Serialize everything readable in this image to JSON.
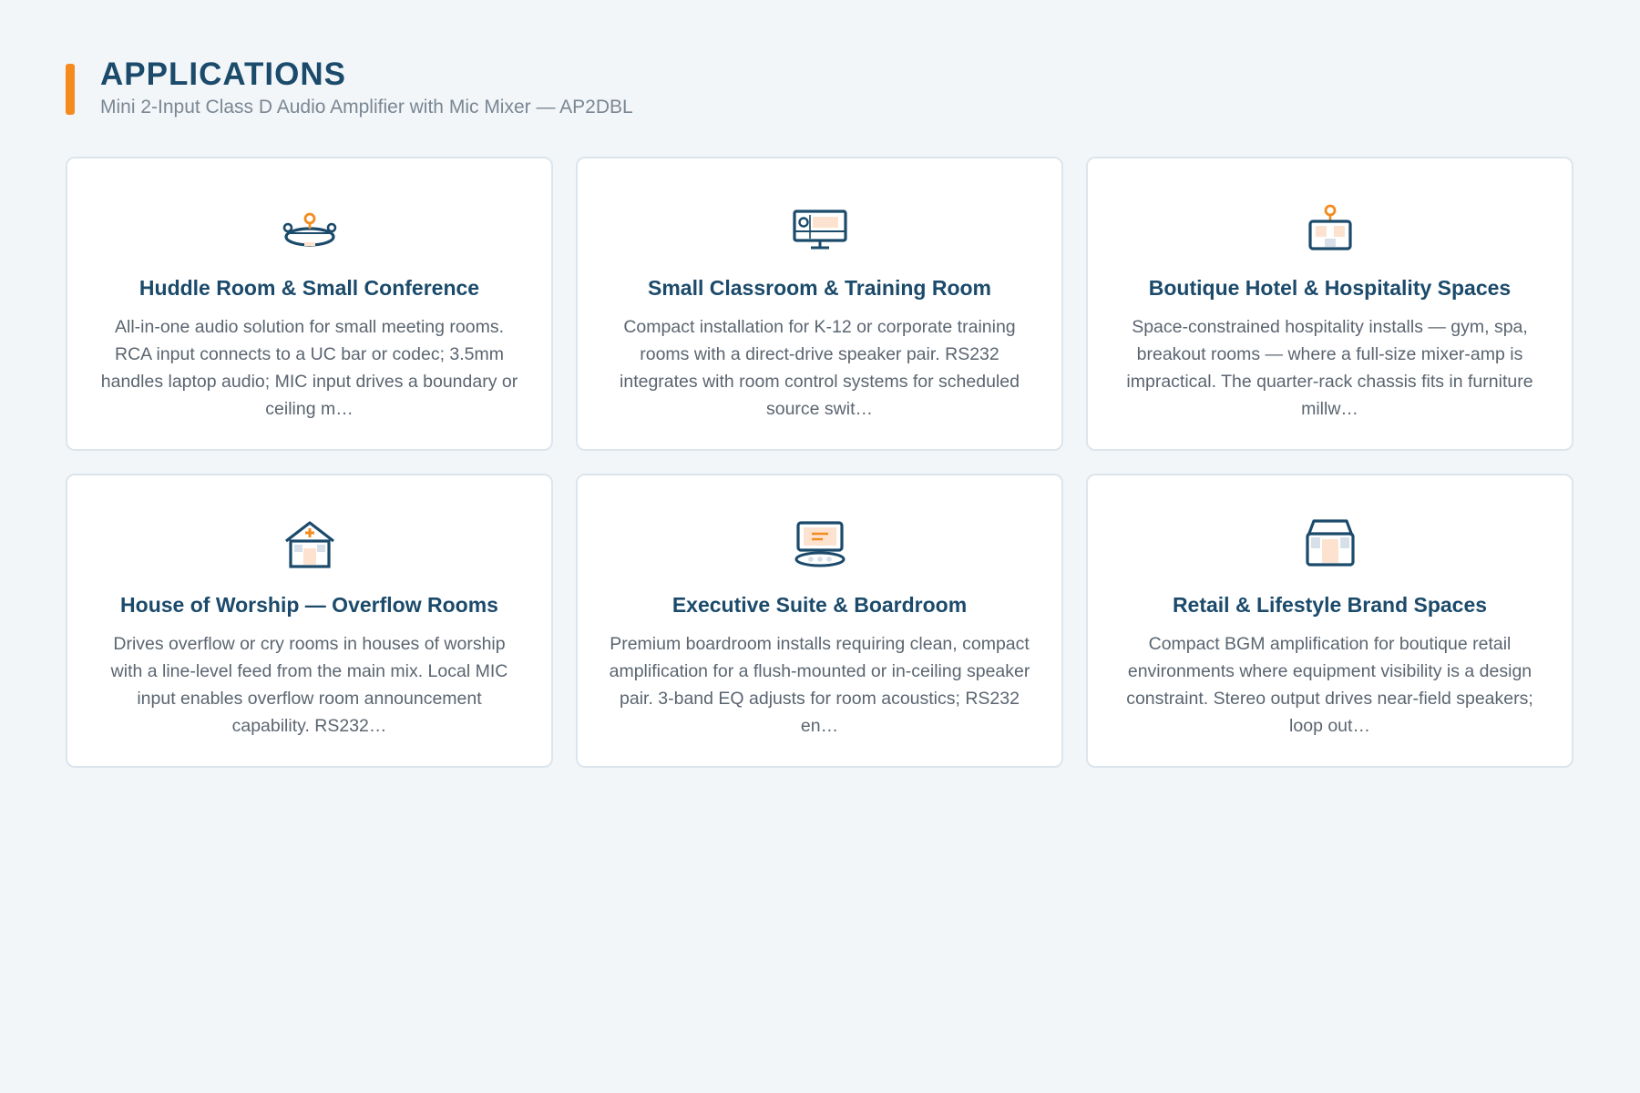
{
  "header": {
    "title": "APPLICATIONS",
    "subtitle": "Mini 2-Input Class D Audio Amplifier with Mic Mixer — AP2DBL",
    "accent_color": "#f58a1f"
  },
  "colors": {
    "primary": "#1b4a6b",
    "accent": "#f58a1f",
    "accent_light": "#fde3cf",
    "muted": "#d7e0e8"
  },
  "cards": [
    {
      "icon": "conference-table-icon",
      "title": "Huddle Room & Small Conference",
      "description": "All-in-one audio solution for small meeting rooms. RCA input connects to a UC bar or codec; 3.5mm handles laptop audio; MIC input drives a boundary or ceiling m…"
    },
    {
      "icon": "classroom-display-icon",
      "title": "Small Classroom & Training Room",
      "description": "Compact installation for K-12 or corporate training rooms with a direct-drive speaker pair. RS232 integrates with room control systems for scheduled source swit…"
    },
    {
      "icon": "hotel-pin-icon",
      "title": "Boutique Hotel & Hospitality Spaces",
      "description": "Space-constrained hospitality installs — gym, spa, breakout rooms — where a full-size mixer-amp is impractical. The quarter-rack chassis fits in furniture millw…"
    },
    {
      "icon": "church-icon",
      "title": "House of Worship — Overflow Rooms",
      "description": "Drives overflow or cry rooms in houses of worship with a line-level feed from the main mix. Local MIC input enables overflow room announcement capability. RS232…"
    },
    {
      "icon": "boardroom-icon",
      "title": "Executive Suite & Boardroom",
      "description": "Premium boardroom installs requiring clean, compact amplification for a flush-mounted or in-ceiling speaker pair. 3-band EQ adjusts for room acoustics; RS232 en…"
    },
    {
      "icon": "storefront-icon",
      "title": "Retail & Lifestyle Brand Spaces",
      "description": "Compact BGM amplification for boutique retail environments where equipment visibility is a design constraint. Stereo output drives near-field speakers; loop out…"
    }
  ]
}
